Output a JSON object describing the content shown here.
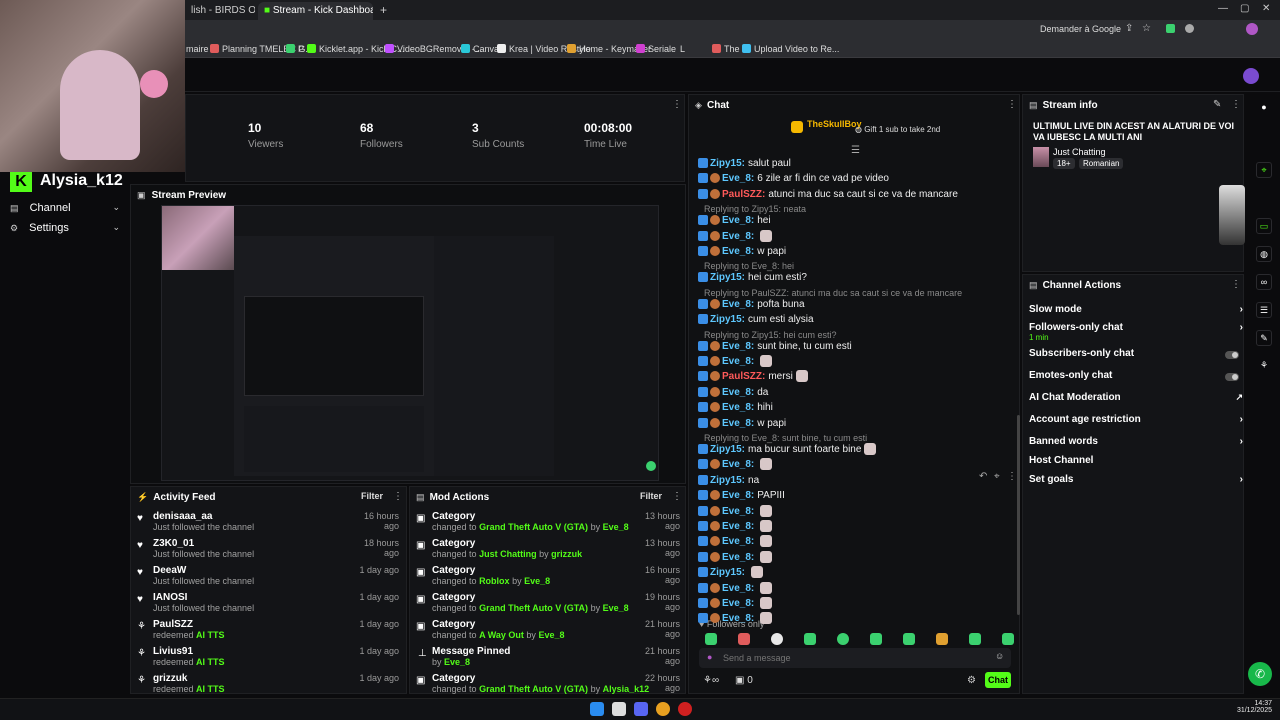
{
  "browser": {
    "tabs": [
      {
        "label": "lish - BIRDS OF"
      },
      {
        "label": "Stream - Kick Dashboard"
      }
    ],
    "address_right": {
      "google_label": "Demander à Google"
    },
    "bookmarks": [
      "maire",
      "Planning TMELEC G...",
      "P",
      "Kicklet.app - Kick C...",
      "VideoBGRemover -...",
      "Canva",
      "Krea | Video Restyle",
      "Home - Keymailer",
      "Seriale",
      "L",
      "The",
      "Upload Video to Re..."
    ]
  },
  "sidebar": {
    "channel_name": "Alysia_k12",
    "items": [
      {
        "label": "Channel"
      },
      {
        "label": "Settings"
      }
    ]
  },
  "stats": [
    {
      "value": "10",
      "label": "Viewers"
    },
    {
      "value": "68",
      "label": "Followers"
    },
    {
      "value": "3",
      "label": "Sub Counts"
    },
    {
      "value": "00:08:00",
      "label": "Time Live"
    }
  ],
  "stream_preview": {
    "title": "Stream Preview"
  },
  "chat": {
    "title": "Chat",
    "pinned_user": "TheSkullBoy",
    "pinned_gift": "Gift 1 sub to take 2nd",
    "messages": [
      {
        "user": "Zipy15:",
        "text": "salut paul",
        "color": "#5ec8ff"
      },
      {
        "user": "Eve_8:",
        "text": "6 zile ar fi din ce vad pe video",
        "color": "#5ec8ff"
      },
      {
        "user": "PaulSZZ:",
        "text": "atunci ma duc sa caut si ce va de mancare",
        "color": "#ff5a5a"
      },
      {
        "reply": "Replying to Zipy15: neata"
      },
      {
        "user": "Eve_8:",
        "text": "hei",
        "color": "#5ec8ff"
      },
      {
        "user": "Eve_8:",
        "text": "",
        "color": "#5ec8ff",
        "emote": true
      },
      {
        "user": "Eve_8:",
        "text": "w papi",
        "color": "#5ec8ff"
      },
      {
        "reply": "Replying to Eve_8: hei"
      },
      {
        "user": "Zipy15:",
        "text": "hei cum esti?",
        "color": "#5ec8ff"
      },
      {
        "reply": "Replying to PaulSZZ: atunci ma duc sa caut si ce va de mancare"
      },
      {
        "user": "Eve_8:",
        "text": "pofta buna",
        "color": "#5ec8ff"
      },
      {
        "user": "Zipy15:",
        "text": "cum esti alysia",
        "color": "#5ec8ff"
      },
      {
        "reply": "Replying to Zipy15: hei cum esti?"
      },
      {
        "user": "Eve_8:",
        "text": "sunt bine, tu cum esti",
        "color": "#5ec8ff"
      },
      {
        "user": "Eve_8:",
        "text": "",
        "color": "#5ec8ff",
        "emote": true
      },
      {
        "user": "PaulSZZ:",
        "text": "mersi",
        "color": "#ff5a5a",
        "emote": true
      },
      {
        "user": "Eve_8:",
        "text": "da",
        "color": "#5ec8ff"
      },
      {
        "user": "Eve_8:",
        "text": "hihi",
        "color": "#5ec8ff"
      },
      {
        "user": "Eve_8:",
        "text": "w papi",
        "color": "#5ec8ff"
      },
      {
        "reply": "Replying to Eve_8: sunt bine, tu cum esti"
      },
      {
        "user": "Zipy15:",
        "text": "ma bucur sunt foarte bine",
        "color": "#5ec8ff",
        "emote": true
      },
      {
        "user": "Eve_8:",
        "text": "",
        "color": "#5ec8ff",
        "emote": true
      },
      {
        "user": "Zipy15:",
        "text": "na",
        "color": "#5ec8ff"
      },
      {
        "user": "Eve_8:",
        "text": "PAPIII",
        "color": "#5ec8ff"
      },
      {
        "user": "Eve_8:",
        "text": "",
        "color": "#5ec8ff",
        "emote": true
      },
      {
        "user": "Eve_8:",
        "text": "",
        "color": "#5ec8ff",
        "emote": true
      },
      {
        "user": "Eve_8:",
        "text": "",
        "color": "#5ec8ff",
        "emote": true
      },
      {
        "user": "Eve_8:",
        "text": "",
        "color": "#5ec8ff",
        "emote": true
      },
      {
        "user": "Zipy15:",
        "text": "",
        "color": "#5ec8ff",
        "emote": true
      },
      {
        "user": "Eve_8:",
        "text": "",
        "color": "#5ec8ff",
        "emote": true
      },
      {
        "user": "Eve_8:",
        "text": "",
        "color": "#5ec8ff",
        "emote": true
      },
      {
        "user": "Eve_8:",
        "text": "",
        "color": "#5ec8ff",
        "emote": true
      }
    ],
    "followers_only": "Followers only",
    "input_placeholder": "Send a message",
    "count": "0",
    "send_label": "Chat"
  },
  "stream_info": {
    "title": "Stream info",
    "stream_title": "ULTIMUL LIVE DIN ACEST AN ALATURI DE VOI VA IUBESC LA MULTI ANI",
    "category": "Just Chatting",
    "tags": [
      "18+",
      "Romanian"
    ]
  },
  "channel_actions": {
    "title": "Channel Actions",
    "items": [
      {
        "label": "Slow mode",
        "control": "chevron"
      },
      {
        "label": "Followers-only chat",
        "sub": "1 min",
        "control": "chevron"
      },
      {
        "label": "Subscribers-only chat",
        "control": "toggle"
      },
      {
        "label": "Emotes-only chat",
        "control": "toggle"
      },
      {
        "label": "AI Chat Moderation",
        "control": "external"
      },
      {
        "label": "Account age restriction",
        "control": "chevron"
      },
      {
        "label": "Banned words",
        "control": "chevron"
      },
      {
        "label": "Host Channel",
        "control": "none"
      },
      {
        "label": "Set goals",
        "control": "chevron"
      }
    ]
  },
  "activity_feed": {
    "title": "Activity Feed",
    "filter_label": "Filter",
    "items": [
      {
        "name": "denisaaa_aa",
        "sub": "Just followed the channel",
        "time": "16 hours ago",
        "icon": "heart"
      },
      {
        "name": "Z3K0_01",
        "sub": "Just followed the channel",
        "time": "18 hours ago",
        "icon": "heart"
      },
      {
        "name": "DeeaW",
        "sub": "Just followed the channel",
        "time": "1 day ago",
        "icon": "heart"
      },
      {
        "name": "IANOSI",
        "sub": "Just followed the channel",
        "time": "1 day ago",
        "icon": "heart"
      },
      {
        "name": "PaulSZZ",
        "sub": "redeemed AI TTS",
        "time": "1 day ago",
        "icon": "gift"
      },
      {
        "name": "Livius91",
        "sub": "redeemed AI TTS",
        "time": "1 day ago",
        "icon": "gift"
      },
      {
        "name": "grizzuk",
        "sub": "redeemed AI TTS",
        "time": "1 day ago",
        "icon": "gift"
      }
    ]
  },
  "mod_actions": {
    "title": "Mod Actions",
    "filter_label": "Filter",
    "items": [
      {
        "name": "Category",
        "sub_pre": "changed to",
        "sub_hl": "Grand Theft Auto V (GTA)",
        "sub_by": "by",
        "sub_user": "Eve_8",
        "time": "13 hours ago"
      },
      {
        "name": "Category",
        "sub_pre": "changed to",
        "sub_hl": "Just Chatting",
        "sub_by": "by",
        "sub_user": "grizzuk",
        "time": "13 hours ago"
      },
      {
        "name": "Category",
        "sub_pre": "changed to",
        "sub_hl": "Roblox",
        "sub_by": "by",
        "sub_user": "Eve_8",
        "time": "16 hours ago"
      },
      {
        "name": "Category",
        "sub_pre": "changed to",
        "sub_hl": "Grand Theft Auto V (GTA)",
        "sub_by": "by",
        "sub_user": "Eve_8",
        "time": "19 hours ago"
      },
      {
        "name": "Category",
        "sub_pre": "changed to",
        "sub_hl": "A Way Out",
        "sub_by": "by",
        "sub_user": "Eve_8",
        "time": "21 hours ago"
      },
      {
        "name": "Message Pinned",
        "sub_pre": "",
        "sub_hl": "",
        "sub_by": "by",
        "sub_user": "Eve_8",
        "time": "21 hours ago"
      },
      {
        "name": "Category",
        "sub_pre": "changed to",
        "sub_hl": "Grand Theft Auto V (GTA)",
        "sub_by": "by",
        "sub_user": "Alysia_k12",
        "time": "22 hours ago"
      }
    ]
  },
  "taskbar": {
    "time": "14:37",
    "date": "31/12/2025"
  },
  "colors": {
    "accent": "#53fc18",
    "bg": "#0b0b0d",
    "panel": "#131417"
  }
}
